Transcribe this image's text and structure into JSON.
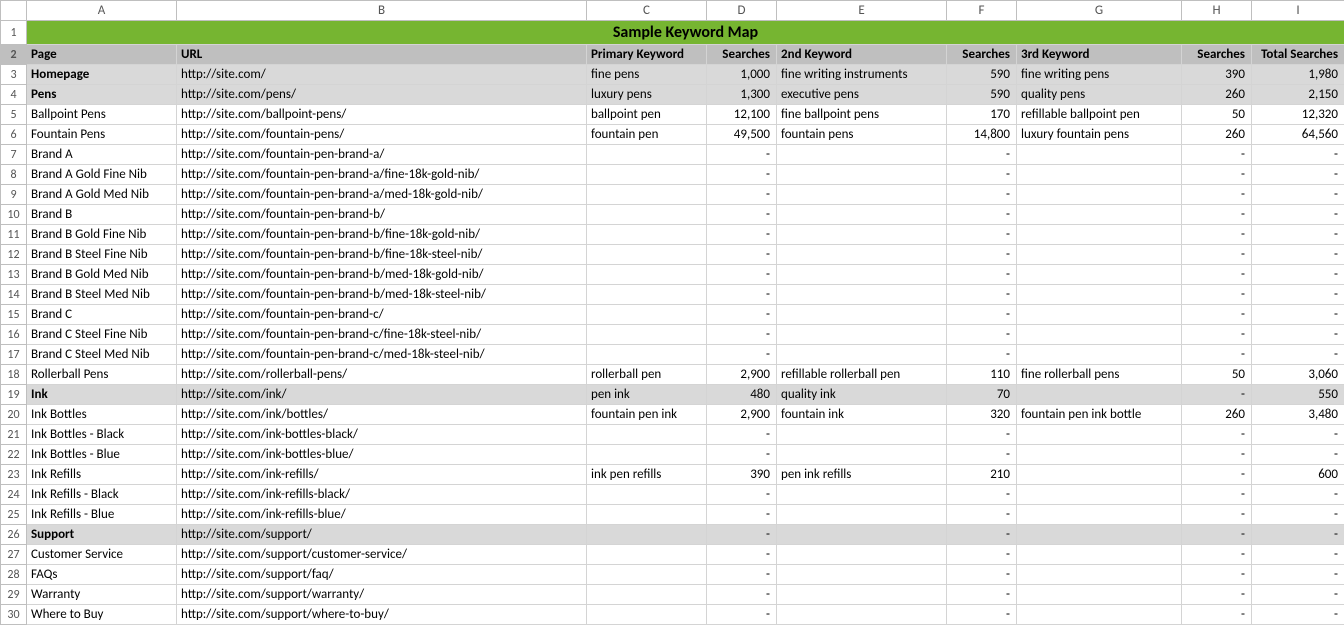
{
  "title": "Sample Keyword Map",
  "col_letters": [
    "A",
    "B",
    "C",
    "D",
    "E",
    "F",
    "G",
    "H",
    "I"
  ],
  "headers": [
    "Page",
    "URL",
    "Primary Keyword",
    "Searches",
    "2nd Keyword",
    "Searches",
    "3rd Keyword",
    "Searches",
    "Total Searches"
  ],
  "chart_data": {
    "type": "table",
    "columns": [
      "Page",
      "URL",
      "Primary Keyword",
      "Searches",
      "2nd Keyword",
      "Searches",
      "3rd Keyword",
      "Searches",
      "Total Searches"
    ],
    "rows": [
      {
        "shade": true,
        "bold": true,
        "page": "Homepage",
        "url": "http://site.com/",
        "pk": "fine pens",
        "s1": "1,000",
        "k2": "fine writing instruments",
        "s2": "590",
        "k3": "fine writing pens",
        "s3": "390",
        "tot": "1,980"
      },
      {
        "shade": true,
        "bold": true,
        "page": "Pens",
        "url": "http://site.com/pens/",
        "pk": "luxury pens",
        "s1": "1,300",
        "k2": "executive pens",
        "s2": "590",
        "k3": "quality pens",
        "s3": "260",
        "tot": "2,150"
      },
      {
        "shade": false,
        "bold": false,
        "page": "Ballpoint Pens",
        "url": "http://site.com/ballpoint-pens/",
        "pk": "ballpoint pen",
        "s1": "12,100",
        "k2": "fine ballpoint pens",
        "s2": "170",
        "k3": "refillable ballpoint pen",
        "s3": "50",
        "tot": "12,320"
      },
      {
        "shade": false,
        "bold": false,
        "page": "Fountain Pens",
        "url": "http://site.com/fountain-pens/",
        "pk": "fountain pen",
        "s1": "49,500",
        "k2": "fountain pens",
        "s2": "14,800",
        "k3": "luxury fountain pens",
        "s3": "260",
        "tot": "64,560"
      },
      {
        "shade": false,
        "bold": false,
        "page": "Brand A",
        "url": "http://site.com/fountain-pen-brand-a/",
        "pk": "",
        "s1": "-",
        "k2": "",
        "s2": "-",
        "k3": "",
        "s3": "-",
        "tot": "-"
      },
      {
        "shade": false,
        "bold": false,
        "page": "Brand A Gold Fine Nib",
        "url": "http://site.com/fountain-pen-brand-a/fine-18k-gold-nib/",
        "pk": "",
        "s1": "-",
        "k2": "",
        "s2": "-",
        "k3": "",
        "s3": "-",
        "tot": "-"
      },
      {
        "shade": false,
        "bold": false,
        "page": "Brand A Gold Med Nib",
        "url": "http://site.com/fountain-pen-brand-a/med-18k-gold-nib/",
        "pk": "",
        "s1": "-",
        "k2": "",
        "s2": "-",
        "k3": "",
        "s3": "-",
        "tot": "-"
      },
      {
        "shade": false,
        "bold": false,
        "page": "Brand B",
        "url": "http://site.com/fountain-pen-brand-b/",
        "pk": "",
        "s1": "-",
        "k2": "",
        "s2": "-",
        "k3": "",
        "s3": "-",
        "tot": "-"
      },
      {
        "shade": false,
        "bold": false,
        "page": "Brand B Gold Fine Nib",
        "url": "http://site.com/fountain-pen-brand-b/fine-18k-gold-nib/",
        "pk": "",
        "s1": "-",
        "k2": "",
        "s2": "-",
        "k3": "",
        "s3": "-",
        "tot": "-"
      },
      {
        "shade": false,
        "bold": false,
        "page": "Brand B Steel Fine Nib",
        "url": "http://site.com/fountain-pen-brand-b/fine-18k-steel-nib/",
        "pk": "",
        "s1": "-",
        "k2": "",
        "s2": "-",
        "k3": "",
        "s3": "-",
        "tot": "-"
      },
      {
        "shade": false,
        "bold": false,
        "page": "Brand B Gold Med Nib",
        "url": "http://site.com/fountain-pen-brand-b/med-18k-gold-nib/",
        "pk": "",
        "s1": "-",
        "k2": "",
        "s2": "-",
        "k3": "",
        "s3": "-",
        "tot": "-"
      },
      {
        "shade": false,
        "bold": false,
        "page": "Brand B Steel Med Nib",
        "url": "http://site.com/fountain-pen-brand-b/med-18k-steel-nib/",
        "pk": "",
        "s1": "-",
        "k2": "",
        "s2": "-",
        "k3": "",
        "s3": "-",
        "tot": "-"
      },
      {
        "shade": false,
        "bold": false,
        "page": "Brand C",
        "url": "http://site.com/fountain-pen-brand-c/",
        "pk": "",
        "s1": "-",
        "k2": "",
        "s2": "-",
        "k3": "",
        "s3": "-",
        "tot": "-"
      },
      {
        "shade": false,
        "bold": false,
        "page": "Brand C Steel Fine Nib",
        "url": "http://site.com/fountain-pen-brand-c/fine-18k-steel-nib/",
        "pk": "",
        "s1": "-",
        "k2": "",
        "s2": "-",
        "k3": "",
        "s3": "-",
        "tot": "-"
      },
      {
        "shade": false,
        "bold": false,
        "page": "Brand C Steel Med Nib",
        "url": "http://site.com/fountain-pen-brand-c/med-18k-steel-nib/",
        "pk": "",
        "s1": "-",
        "k2": "",
        "s2": "-",
        "k3": "",
        "s3": "-",
        "tot": "-"
      },
      {
        "shade": false,
        "bold": false,
        "page": "Rollerball Pens",
        "url": "http://site.com/rollerball-pens/",
        "pk": "rollerball pen",
        "s1": "2,900",
        "k2": "refillable rollerball pen",
        "s2": "110",
        "k3": "fine rollerball pens",
        "s3": "50",
        "tot": "3,060"
      },
      {
        "shade": true,
        "bold": true,
        "page": "Ink",
        "url": "http://site.com/ink/",
        "pk": "pen ink",
        "s1": "480",
        "k2": "quality ink",
        "s2": "70",
        "k3": "",
        "s3": "-",
        "tot": "550"
      },
      {
        "shade": false,
        "bold": false,
        "page": "Ink Bottles",
        "url": "http://site.com/ink/bottles/",
        "pk": "fountain pen ink",
        "s1": "2,900",
        "k2": "fountain ink",
        "s2": "320",
        "k3": "fountain pen ink bottle",
        "s3": "260",
        "tot": "3,480"
      },
      {
        "shade": false,
        "bold": false,
        "page": "Ink Bottles - Black",
        "url": "http://site.com/ink-bottles-black/",
        "pk": "",
        "s1": "-",
        "k2": "",
        "s2": "-",
        "k3": "",
        "s3": "-",
        "tot": "-"
      },
      {
        "shade": false,
        "bold": false,
        "page": "Ink Bottles - Blue",
        "url": "http://site.com/ink-bottles-blue/",
        "pk": "",
        "s1": "-",
        "k2": "",
        "s2": "-",
        "k3": "",
        "s3": "-",
        "tot": "-"
      },
      {
        "shade": false,
        "bold": false,
        "page": "Ink Refills",
        "url": "http://site.com/ink-refills/",
        "pk": "ink pen refills",
        "s1": "390",
        "k2": "pen ink refills",
        "s2": "210",
        "k3": "",
        "s3": "-",
        "tot": "600"
      },
      {
        "shade": false,
        "bold": false,
        "page": "Ink Refills - Black",
        "url": "http://site.com/ink-refills-black/",
        "pk": "",
        "s1": "-",
        "k2": "",
        "s2": "-",
        "k3": "",
        "s3": "-",
        "tot": "-"
      },
      {
        "shade": false,
        "bold": false,
        "page": "Ink Refills - Blue",
        "url": "http://site.com/ink-refills-blue/",
        "pk": "",
        "s1": "-",
        "k2": "",
        "s2": "-",
        "k3": "",
        "s3": "-",
        "tot": "-"
      },
      {
        "shade": true,
        "bold": true,
        "page": "Support",
        "url": "http://site.com/support/",
        "pk": "",
        "s1": "-",
        "k2": "",
        "s2": "-",
        "k3": "",
        "s3": "-",
        "tot": "-"
      },
      {
        "shade": false,
        "bold": false,
        "page": "Customer Service",
        "url": "http://site.com/support/customer-service/",
        "pk": "",
        "s1": "-",
        "k2": "",
        "s2": "-",
        "k3": "",
        "s3": "-",
        "tot": "-"
      },
      {
        "shade": false,
        "bold": false,
        "page": "FAQs",
        "url": "http://site.com/support/faq/",
        "pk": "",
        "s1": "-",
        "k2": "",
        "s2": "-",
        "k3": "",
        "s3": "-",
        "tot": "-"
      },
      {
        "shade": false,
        "bold": false,
        "page": "Warranty",
        "url": "http://site.com/support/warranty/",
        "pk": "",
        "s1": "-",
        "k2": "",
        "s2": "-",
        "k3": "",
        "s3": "-",
        "tot": "-"
      },
      {
        "shade": false,
        "bold": false,
        "page": "Where to Buy",
        "url": "http://site.com/support/where-to-buy/",
        "pk": "",
        "s1": "-",
        "k2": "",
        "s2": "-",
        "k3": "",
        "s3": "-",
        "tot": "-"
      }
    ]
  }
}
